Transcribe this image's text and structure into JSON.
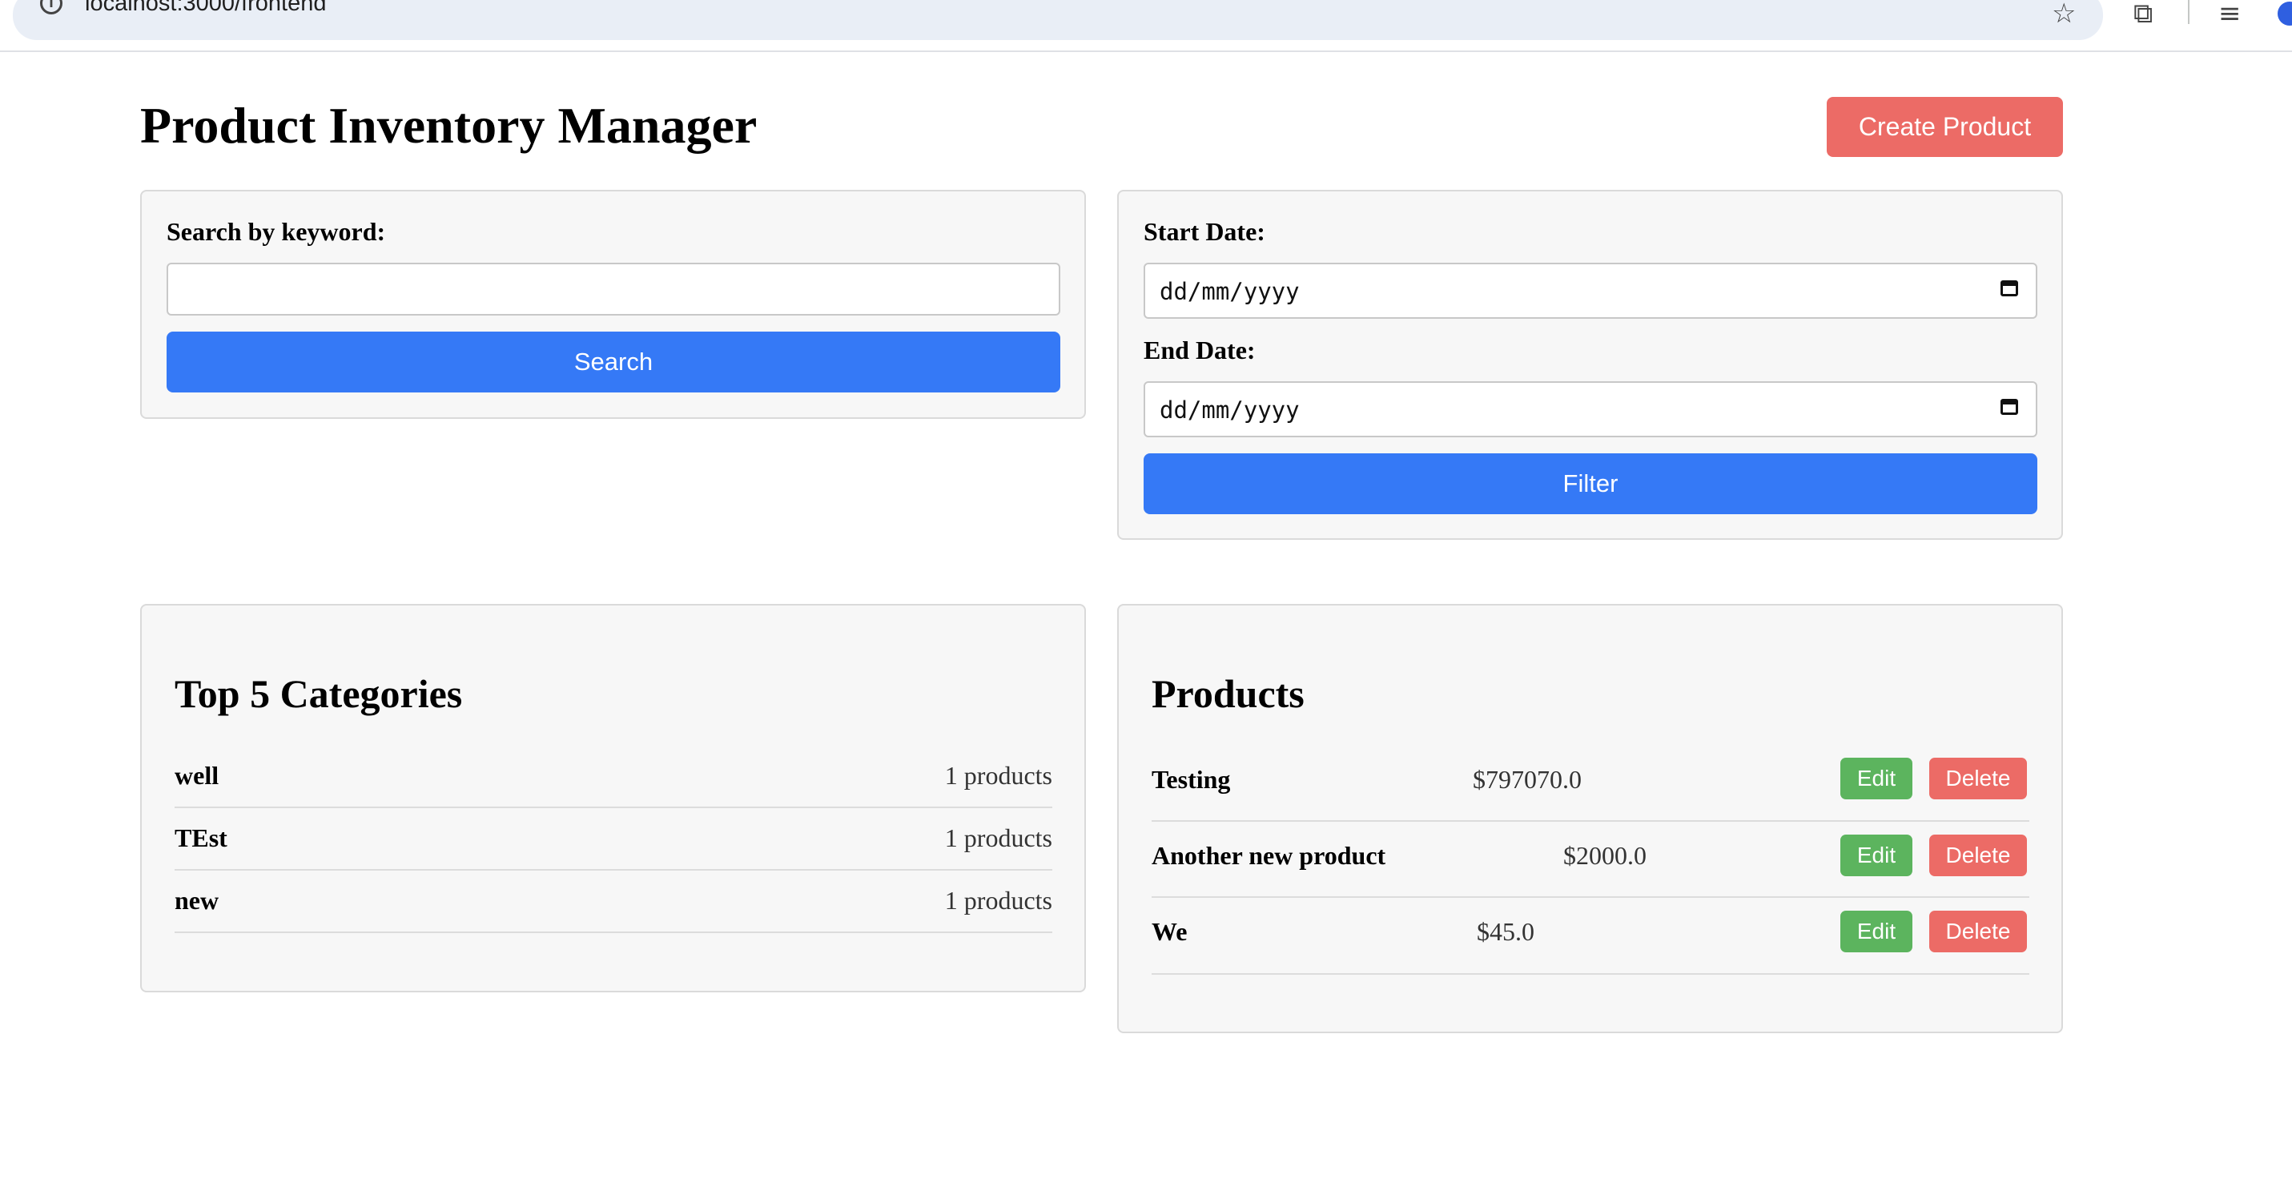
{
  "browser": {
    "url": "localhost:3000/frontend",
    "icons": [
      "info-icon",
      "star-icon",
      "extensions-icon",
      "media-icon",
      "profile-icon"
    ]
  },
  "header": {
    "title": "Product Inventory Manager",
    "create_label": "Create Product"
  },
  "search": {
    "label": "Search by keyword:",
    "value": "",
    "button_label": "Search"
  },
  "filter": {
    "start_label": "Start Date:",
    "start_value": "dd/mm/yyyy",
    "end_label": "End Date:",
    "end_value": "dd/mm/yyyy",
    "button_label": "Filter"
  },
  "categories": {
    "title": "Top 5 Categories",
    "items": [
      {
        "name": "well",
        "count": "1 products"
      },
      {
        "name": "TEst",
        "count": "1 products"
      },
      {
        "name": "new",
        "count": "1 products"
      }
    ]
  },
  "products": {
    "title": "Products",
    "edit_label": "Edit",
    "delete_label": "Delete",
    "items": [
      {
        "name": "Testing",
        "price": "$797070.0"
      },
      {
        "name": "Another new product",
        "price": "$2000.0"
      },
      {
        "name": "We",
        "price": "$45.0"
      }
    ]
  },
  "colors": {
    "primary": "#3579f6",
    "danger": "#ec6b66",
    "success": "#5cb45e",
    "panel_bg": "#f7f7f7"
  }
}
